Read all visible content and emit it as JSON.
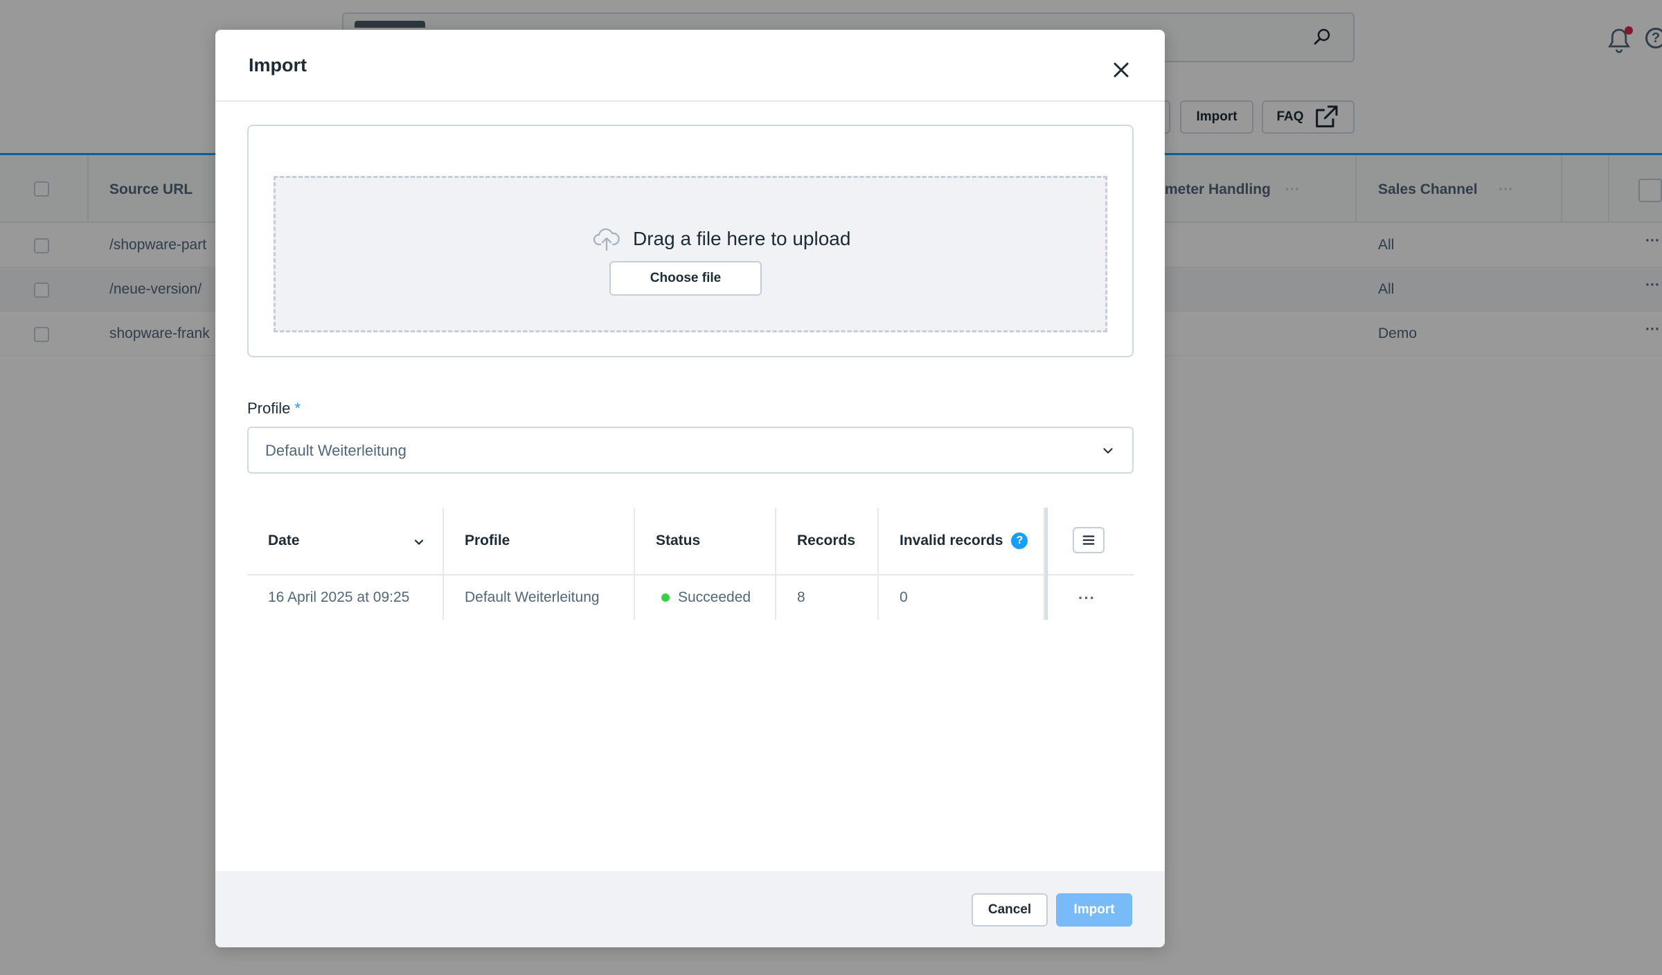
{
  "background": {
    "toolbar": {
      "import_label": "Import",
      "faq_label": "FAQ"
    },
    "grid": {
      "columns": [
        "Source URL",
        "meter Handling",
        "Sales Channel"
      ],
      "rows": [
        {
          "source": "/shopware-part",
          "sales_channel": "All"
        },
        {
          "source": "/neue-version/",
          "sales_channel": "All"
        },
        {
          "source": "shopware-frank",
          "sales_channel": "Demo"
        }
      ],
      "ellipsis": "···"
    }
  },
  "modal": {
    "title": "Import",
    "upload": {
      "prompt": "Drag a file here to upload",
      "choose_label": "Choose file"
    },
    "profile": {
      "label": "Profile",
      "required_mark": "*",
      "selected": "Default Weiterleitung"
    },
    "log_table": {
      "headers": {
        "date": "Date",
        "profile": "Profile",
        "status": "Status",
        "records": "Records",
        "invalid": "Invalid records"
      },
      "info_glyph": "?",
      "rows": [
        {
          "date": "16 April 2025 at 09:25",
          "profile": "Default Weiterleitung",
          "status": "Succeeded",
          "records": "8",
          "invalid": "0",
          "actions": "···"
        }
      ]
    },
    "footer": {
      "cancel_label": "Cancel",
      "import_label": "Import"
    }
  },
  "colors": {
    "accent": "#189eff",
    "primary_disabled": "#79baf8",
    "success": "#37d046",
    "notification": "#de294c"
  },
  "icons": {
    "search": "search-icon",
    "bell": "bell-icon",
    "help": "help-icon",
    "external": "external-link-icon",
    "close": "close-icon",
    "upload": "cloud-upload-icon",
    "chevron": "chevron-down-icon",
    "sort": "sort-down-icon",
    "info": "info-icon",
    "column_settings": "list-icon"
  }
}
